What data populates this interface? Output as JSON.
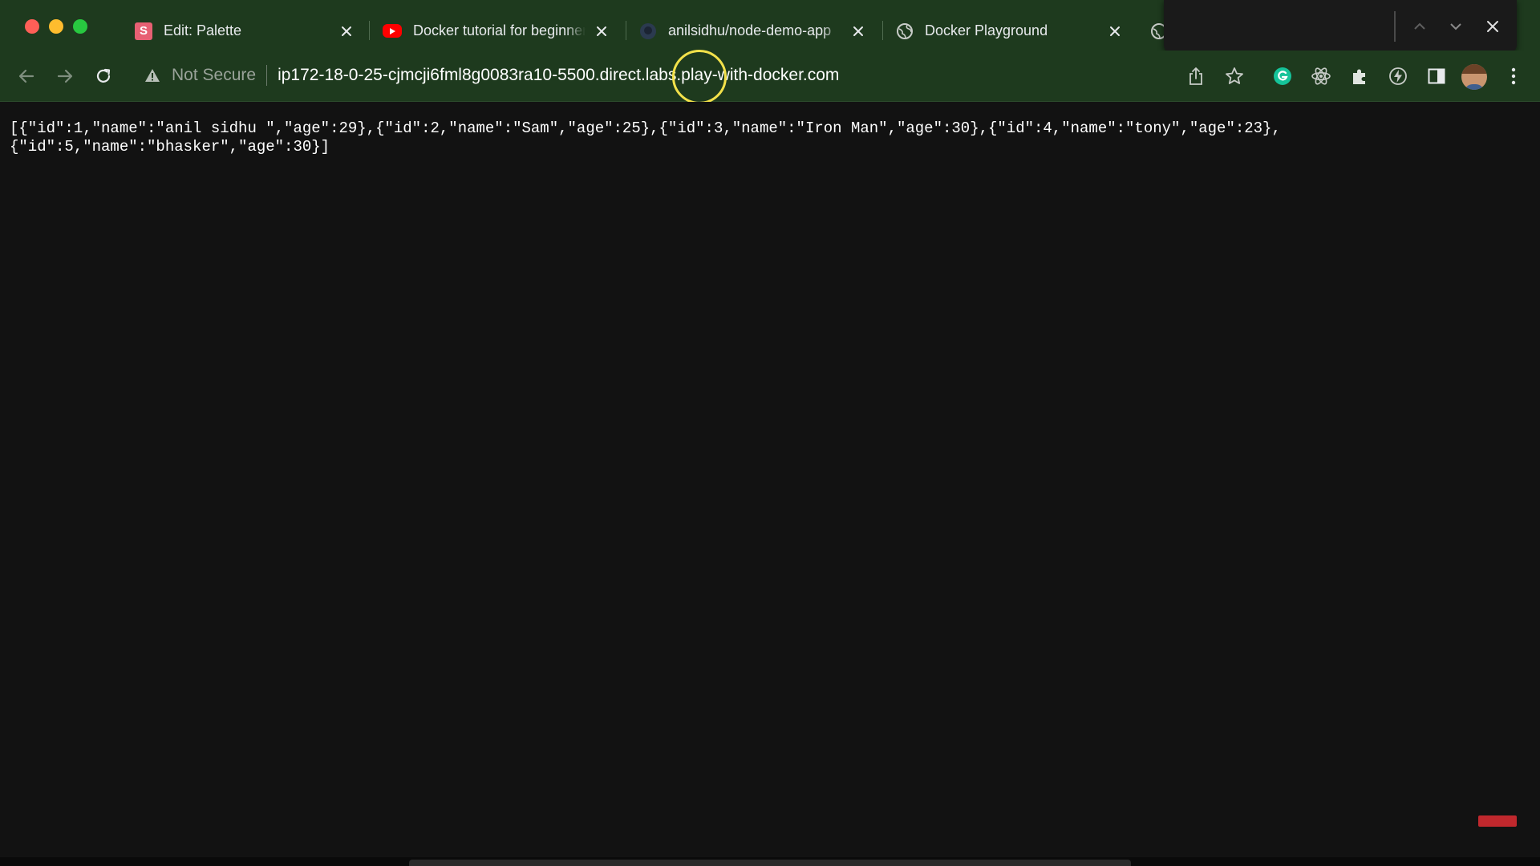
{
  "colors": {
    "chrome_frame": "#1e3a1e",
    "page_background": "#121212",
    "text": "#ffffff",
    "muted_text": "#9aa39a",
    "cursor_highlight": "#f2e14a"
  },
  "tabs": [
    {
      "title": "Edit: Palette",
      "icon": "letter-s-favicon"
    },
    {
      "title": "Docker tutorial for beginners",
      "icon": "youtube-icon"
    },
    {
      "title": "anilsidhu/node-demo-app",
      "icon": "github-icon"
    },
    {
      "title": "Docker Playground",
      "icon": "globe-icon"
    }
  ],
  "find_bar": {
    "icons": [
      "chevron-up-icon",
      "chevron-down-icon",
      "close-icon"
    ]
  },
  "toolbar": {
    "security_label": "Not Secure",
    "url": "ip172-18-0-25-cjmcji6fml8g0083ra10-5500.direct.labs.play-with-docker.com",
    "icons": [
      "back-icon",
      "forward-icon",
      "reload-icon",
      "share-icon",
      "bookmark-star-icon",
      "grammarly-icon",
      "react-devtools-icon",
      "extensions-icon",
      "lightning-icon",
      "side-panel-icon",
      "profile-avatar",
      "menu-icon"
    ]
  },
  "page": {
    "response_text": "[{\"id\":1,\"name\":\"anil sidhu \",\"age\":29},{\"id\":2,\"name\":\"Sam\",\"age\":25},{\"id\":3,\"name\":\"Iron Man\",\"age\":30},{\"id\":4,\"name\":\"tony\",\"age\":23},\n{\"id\":5,\"name\":\"bhasker\",\"age\":30}]"
  }
}
